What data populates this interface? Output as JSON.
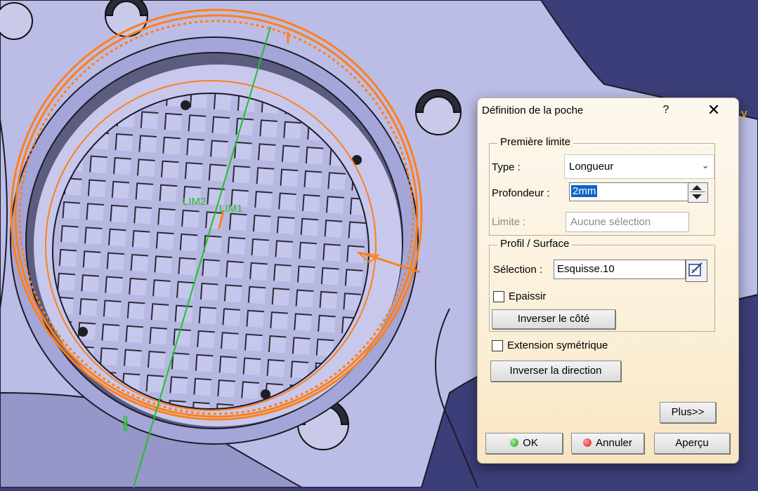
{
  "dialog": {
    "title": "Définition de la poche",
    "help": "?",
    "close": "✕"
  },
  "first_limit": {
    "legend": "Première limite",
    "type_label": "Type :",
    "type_value": "Longueur",
    "depth_label": "Profondeur :",
    "depth_value": "2mm",
    "limit_label": "Limite :",
    "limit_value": "Aucune sélection"
  },
  "profile": {
    "legend": "Profil / Surface",
    "selection_label": "Sélection :",
    "selection_value": "Esquisse.10",
    "thicken_label": "Epaissir",
    "reverse_side": "Inverser le côté"
  },
  "sym_extension_label": "Extension symétrique",
  "reverse_direction": "Inverser la direction",
  "more": "Plus>>",
  "ok": "OK",
  "cancel": "Annuler",
  "preview": "Aperçu",
  "viewport": {
    "lim2": "LIM2",
    "lim1": "LIM1",
    "axis_letter": "y"
  },
  "colors": {
    "background": "#3b3e78",
    "part": "#bcbde6",
    "highlight": "#ff7f1a",
    "axis": "#22c02a",
    "ok_dot": "#22a022",
    "cancel_dot": "#d22020"
  }
}
